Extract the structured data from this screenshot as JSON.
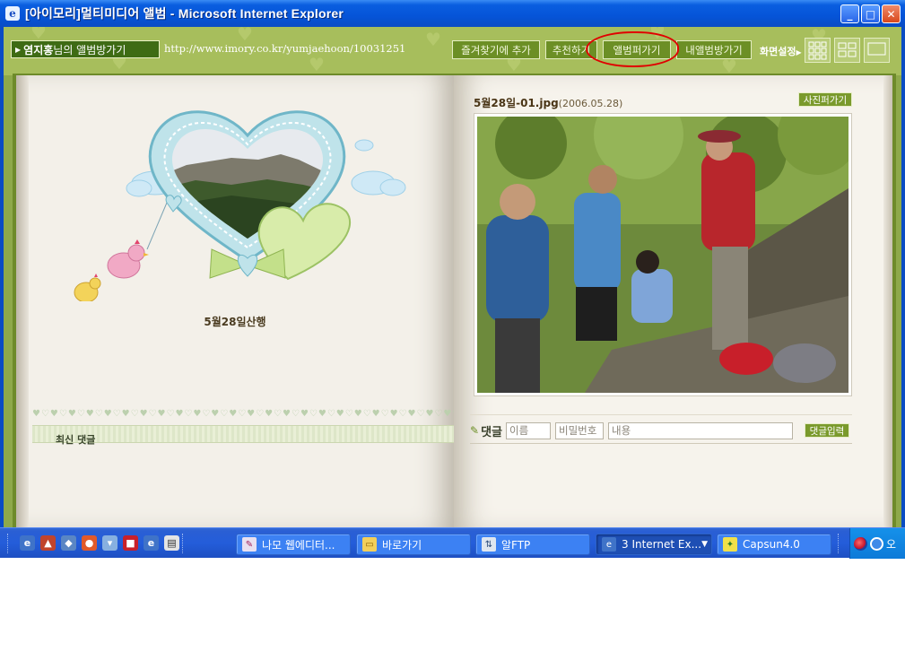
{
  "window": {
    "title": "[아이모리]멀티미디어 앨범 - Microsoft Internet Explorer",
    "icon": "ie-page-icon",
    "buttons": {
      "minimize": "_",
      "maximize": "□",
      "close": "✕"
    }
  },
  "album_bar": {
    "owner_link_name": "염지홍",
    "owner_link_suffix": "님의 앨범방가기",
    "url": "http://www.imory.co.kr/yumjaehoon/10031251",
    "buttons": [
      "즐겨찾기에 추가",
      "추천하기",
      "앨범퍼가기",
      "내앨범방가기"
    ],
    "screen_setting": "화면설정",
    "highlight_color": "#e00000"
  },
  "left_page": {
    "caption": "5월28일산행",
    "latest_comments_label": "최신 댓글"
  },
  "right_page": {
    "photo_name": "5월28일-01.jpg",
    "photo_date": "(2006.05.28)",
    "scrap_photo_button": "사진퍼가기",
    "comment_label": "댓글",
    "name_placeholder": "이름",
    "password_placeholder": "비밀번호",
    "content_placeholder": "내용",
    "submit_button": "댓글입력"
  },
  "taskbar": {
    "tasks": [
      {
        "label": "나모 웹에디터...",
        "icon": "namo-icon"
      },
      {
        "label": "바로가기",
        "icon": "folder-icon"
      },
      {
        "label": "알FTP",
        "icon": "ftp-icon"
      },
      {
        "label": "3 Internet Ex...",
        "icon": "ie-icon"
      },
      {
        "label": "Capsun4.0",
        "icon": "capsun-icon"
      }
    ],
    "clock": "오"
  }
}
